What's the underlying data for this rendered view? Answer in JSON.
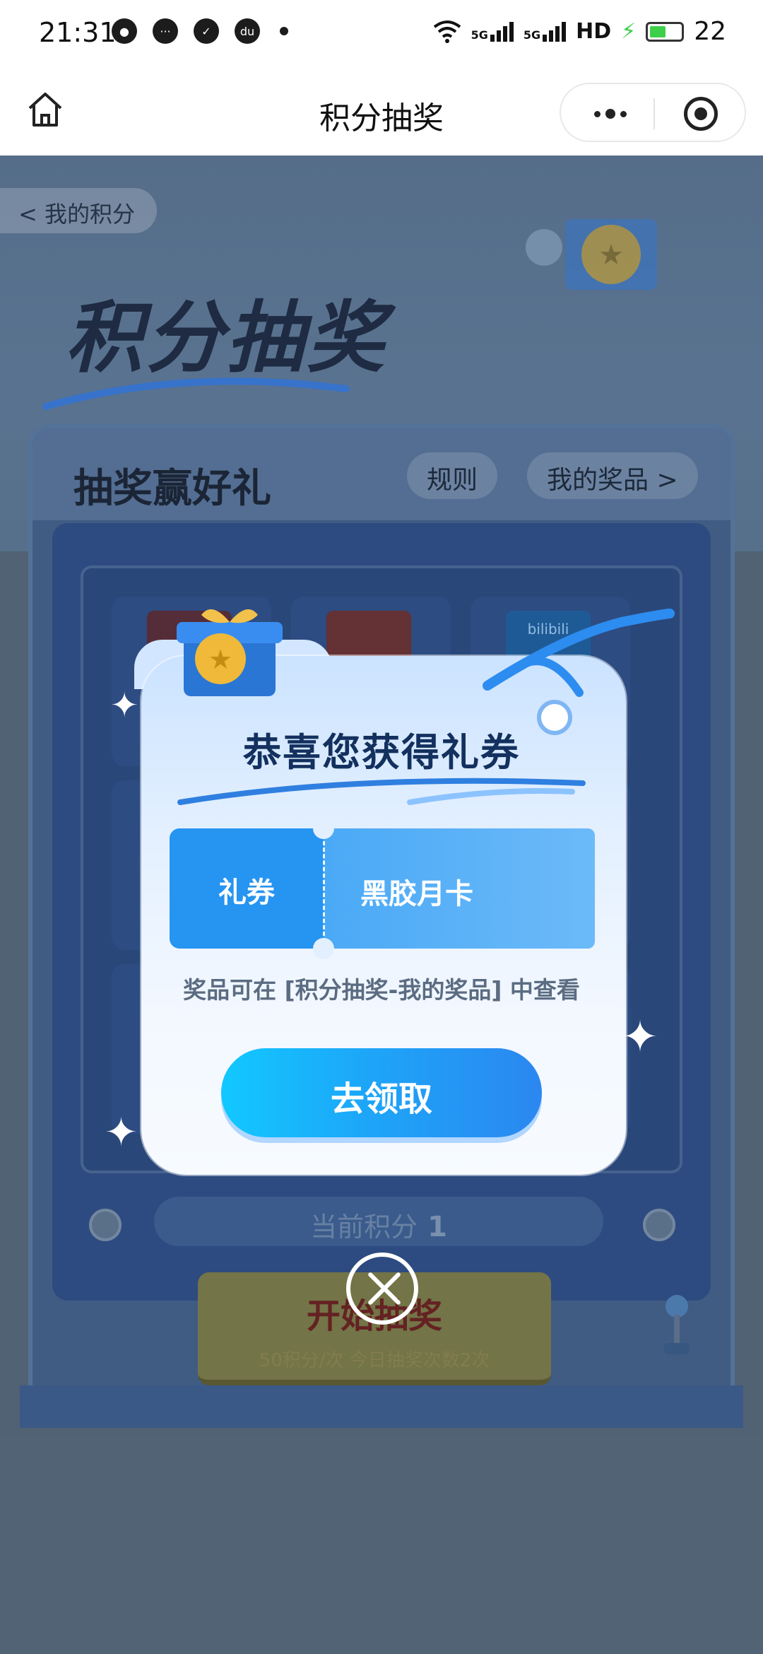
{
  "status_bar": {
    "time": "21:31",
    "net_1": "5G",
    "net_2": "5G",
    "hd": "HD",
    "battery": "22",
    "icons": [
      "chat-bubble-icon",
      "message-icon",
      "check-circle-icon",
      "du-location-icon",
      "dot-icon",
      "wifi-icon",
      "signal-icon",
      "signal-icon",
      "charging-icon",
      "battery-icon"
    ]
  },
  "title_bar": {
    "title": "积分抽奖"
  },
  "page": {
    "back_label": "< 我的积分",
    "hero_title": "积分抽奖",
    "section_title": "抽奖赢好礼",
    "rules_button": "规则",
    "my_prizes_button": "我的奖品 >",
    "score_label": "当前积分",
    "score_value": "1",
    "start_button": "开始抽奖",
    "start_sub": "50积分/次 今日抽奖次数2次",
    "prize_brand": "bilibili"
  },
  "dialog": {
    "title": "恭喜您获得礼券",
    "coupon_type": "礼券",
    "coupon_name": "黑胶月卡",
    "note": "奖品可在 [积分抽奖-我的奖品] 中查看",
    "claim_button": "去领取"
  },
  "colors": {
    "accent": "#1da6f8",
    "dialog_title": "#13305e",
    "coupon_blue": "#2694f1"
  }
}
